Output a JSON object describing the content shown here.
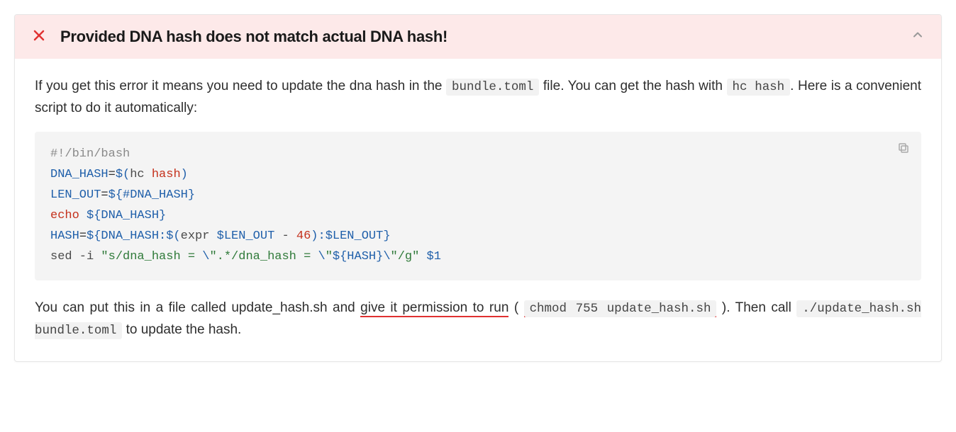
{
  "header": {
    "title": "Provided DNA hash does not match actual DNA hash!"
  },
  "body": {
    "intro_before": "If you get this error it means you need to update the dna hash in the ",
    "bundle_file": "bundle.toml",
    "intro_mid": " file. You can get the hash with ",
    "hc_hash": "hc hash",
    "intro_after": ". Here is a convenient script to do it automatically:",
    "outro_before": "You can put this in a file called update_hash.sh and ",
    "outro_perm": "give it permission to run",
    "outro_paren_open": " ( ",
    "chmod_cmd": "chmod 755 update_hash.sh",
    "outro_paren_close": " ). Then call ",
    "run_cmd": "./update_hash.sh bundle.toml",
    "outro_end": " to update the hash."
  },
  "code": {
    "l1_shebang": "#!/bin/bash",
    "l2_var": "DNA_HASH",
    "l2_eq": "=",
    "l2_dollar": "$(",
    "l2_hc": "hc ",
    "l2_hash": "hash",
    "l2_close": ")",
    "l3_var": "LEN_OUT",
    "l3_eq": "=",
    "l3_expr": "${#DNA_HASH}",
    "l4_echo": "echo",
    "l4_arg": "${DNA_HASH}",
    "l5_var": "HASH",
    "l5_eq": "=",
    "l5_open": "${DNA_HASH:",
    "l5_sub_open": "$(",
    "l5_expr": "expr ",
    "l5_len": "$LEN_OUT",
    "l5_minus": " - ",
    "l5_num": "46",
    "l5_sub_close": ")",
    "l5_colon": ":",
    "l5_len2": "$LEN_OUT",
    "l5_close": "}",
    "l6_sed": "sed -i ",
    "l6_str_open": "\"s/dna_hash = ",
    "l6_esc1": "\\",
    "l6_mid1": "\".*/dna_hash = ",
    "l6_esc2": "\\",
    "l6_mid2": "\"",
    "l6_hashvar": "${HASH}",
    "l6_esc3": "\\",
    "l6_end": "\"/g\"",
    "l6_sp": " ",
    "l6_arg": "$1"
  }
}
